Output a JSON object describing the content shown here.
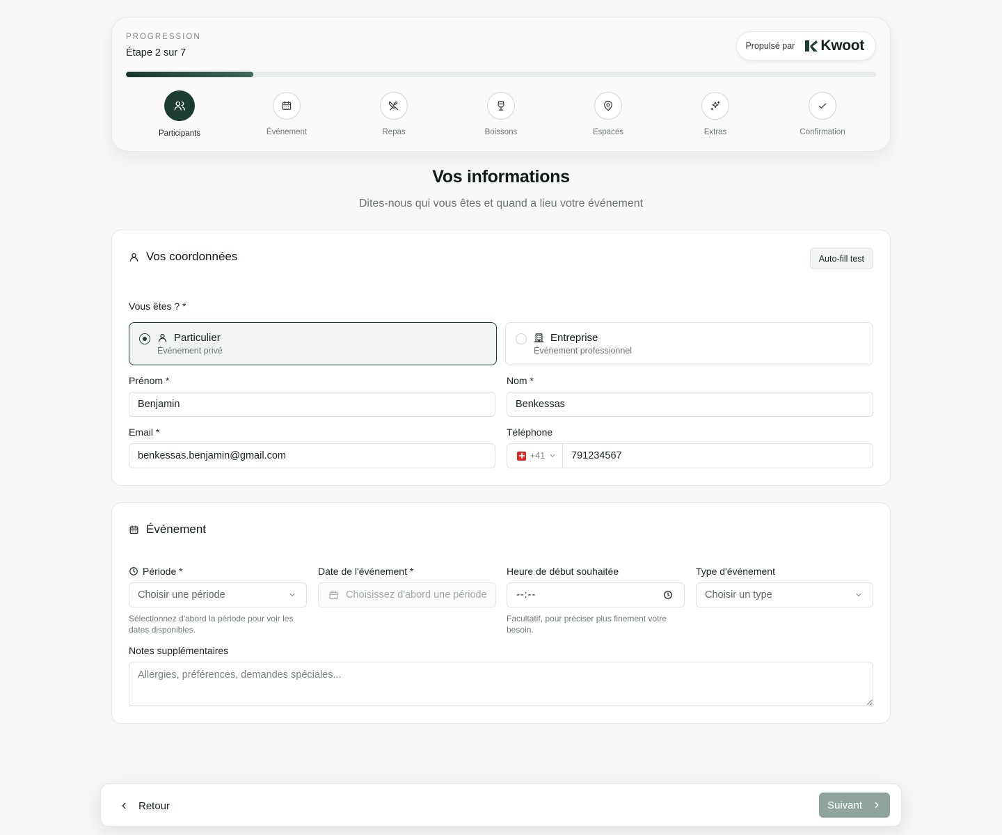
{
  "progress": {
    "label": "PROGRESSION",
    "step_text": "Étape 2 sur 7",
    "fraction": 0.17,
    "powered_by": "Propulsé par",
    "brand": "Kwoot"
  },
  "steps": [
    {
      "label": "Participants",
      "icon": "users-icon",
      "active": true
    },
    {
      "label": "Événement",
      "icon": "calendar-icon",
      "active": false
    },
    {
      "label": "Repas",
      "icon": "utensils-crossed-icon",
      "active": false
    },
    {
      "label": "Boissons",
      "icon": "wine-glass-icon",
      "active": false
    },
    {
      "label": "Espaces",
      "icon": "map-pin-icon",
      "active": false
    },
    {
      "label": "Extras",
      "icon": "sparkles-icon",
      "active": false
    },
    {
      "label": "Confirmation",
      "icon": "check-icon",
      "active": false
    }
  ],
  "heading": {
    "title": "Vos informations",
    "subtitle": "Dites-nous qui vous êtes et quand a lieu votre événement"
  },
  "contact": {
    "title": "Vos coordonnées",
    "autofill": "Auto-fill test",
    "type_label": "Vous êtes ? *",
    "options": [
      {
        "title": "Particulier",
        "subtitle": "Événement privé",
        "selected": true
      },
      {
        "title": "Entreprise",
        "subtitle": "Événement professionnel",
        "selected": false
      }
    ],
    "firstname_label": "Prénom *",
    "firstname_value": "Benjamin",
    "lastname_label": "Nom *",
    "lastname_value": "Benkessas",
    "email_label": "Email *",
    "email_value": "benkessas.benjamin@gmail.com",
    "phone_label": "Téléphone",
    "phone_prefix": "+41",
    "phone_value": "791234567"
  },
  "event": {
    "title": "Événement",
    "period_label": "Période *",
    "period_placeholder": "Choisir une période",
    "period_helper": "Sélectionnez d'abord la période pour voir les dates disponibles.",
    "date_label": "Date de l'événement *",
    "date_placeholder": "Choisissez d'abord une période",
    "time_label": "Heure de début souhaitée",
    "time_value": "--:--",
    "time_helper": "Facultatif, pour préciser plus finement votre besoin.",
    "type_label": "Type d'événement",
    "type_placeholder": "Choisir un type",
    "notes_label": "Notes supplémentaires",
    "notes_placeholder": "Allergies, préférences, demandes spéciales..."
  },
  "footer": {
    "back": "Retour",
    "next": "Suivant"
  },
  "colors": {
    "primary": "#1c3d34",
    "disabled_button": "#8fa49d",
    "background": "#f7f8f7"
  }
}
